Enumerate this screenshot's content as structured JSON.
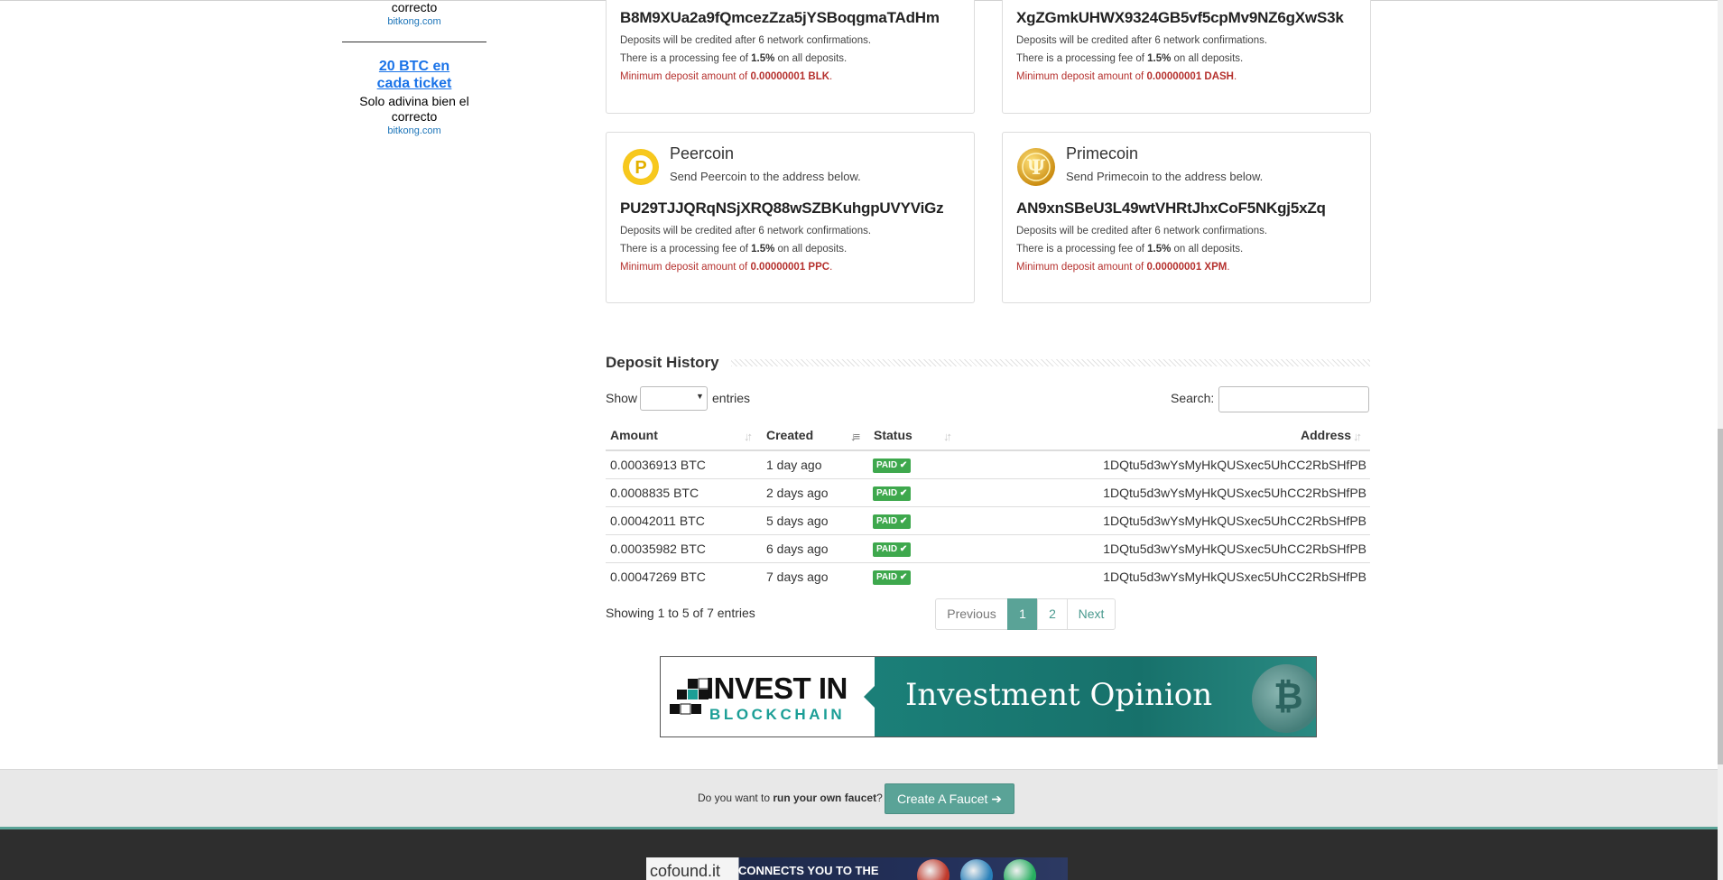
{
  "sidebar": {
    "ad1": {
      "text_tail": "correcto",
      "source": "bitkong.com"
    },
    "ad2": {
      "title": "20 BTC en cada ticket",
      "text": "Solo adivina bien el correcto",
      "source": "bitkong.com"
    }
  },
  "coins": [
    {
      "address": "B8M9XUa2a9fQmcezZza5jYSBoqgmaTAdHm",
      "line1": "Deposits will be credited after 6 network confirmations.",
      "fee_pre": "There is a processing fee of ",
      "fee": "1.5%",
      "fee_post": " on all deposits.",
      "min_pre": "Minimum deposit amount of ",
      "min": "0.00000001 BLK",
      "min_post": "."
    },
    {
      "address": "XgZGmkUHWX9324GB5vf5cpMv9NZ6gXwS3k",
      "line1": "Deposits will be credited after 6 network confirmations.",
      "fee_pre": "There is a processing fee of ",
      "fee": "1.5%",
      "fee_post": " on all deposits.",
      "min_pre": "Minimum deposit amount of ",
      "min": "0.00000001 DASH",
      "min_post": "."
    },
    {
      "name": "Peercoin",
      "send": "Send Peercoin to the address below.",
      "address": "PU29TJJQRqNSjXRQ88wSZBKuhgpUVYViGz",
      "line1": "Deposits will be credited after 6 network confirmations.",
      "fee_pre": "There is a processing fee of ",
      "fee": "1.5%",
      "fee_post": " on all deposits.",
      "min_pre": "Minimum deposit amount of ",
      "min": "0.00000001 PPC",
      "min_post": ".",
      "logo_color": "#f5c518",
      "logo_glyph": "P"
    },
    {
      "name": "Primecoin",
      "send": "Send Primecoin to the address below.",
      "address": "AN9xnSBeU3L49wtVHRtJhxCoF5NKgj5xZq",
      "line1": "Deposits will be credited after 6 network confirmations.",
      "fee_pre": "There is a processing fee of ",
      "fee": "1.5%",
      "fee_post": " on all deposits.",
      "min_pre": "Minimum deposit amount of ",
      "min": "0.00000001 XPM",
      "min_post": ".",
      "logo_color": "#d9a21b",
      "logo_glyph": "Ψ"
    }
  ],
  "history": {
    "title": "Deposit History",
    "show_label": "Show",
    "entries_label": "entries",
    "search_label": "Search:",
    "columns": {
      "amount": "Amount",
      "created": "Created",
      "status": "Status",
      "address": "Address"
    },
    "rows": [
      {
        "amount": "0.00036913 BTC",
        "created": "1 day ago",
        "status": "PAID ✔",
        "address": "1DQtu5d3wYsMyHkQUSxec5UhCC2RbSHfPB"
      },
      {
        "amount": "0.0008835 BTC",
        "created": "2 days ago",
        "status": "PAID ✔",
        "address": "1DQtu5d3wYsMyHkQUSxec5UhCC2RbSHfPB"
      },
      {
        "amount": "0.00042011 BTC",
        "created": "5 days ago",
        "status": "PAID ✔",
        "address": "1DQtu5d3wYsMyHkQUSxec5UhCC2RbSHfPB"
      },
      {
        "amount": "0.00035982 BTC",
        "created": "6 days ago",
        "status": "PAID ✔",
        "address": "1DQtu5d3wYsMyHkQUSxec5UhCC2RbSHfPB"
      },
      {
        "amount": "0.00047269 BTC",
        "created": "7 days ago",
        "status": "PAID ✔",
        "address": "1DQtu5d3wYsMyHkQUSxec5UhCC2RbSHfPB"
      }
    ],
    "info": "Showing 1 to 5 of 7 entries",
    "pagination": {
      "previous": "Previous",
      "page1": "1",
      "page2": "2",
      "next": "Next"
    }
  },
  "banner": {
    "invest": "INVEST IN",
    "blockchain": "BLOCKCHAIN",
    "opinion": "Investment Opinion"
  },
  "footer": {
    "question_pre": "Do you want to ",
    "question_bold": "run your own faucet",
    "question_post": "?",
    "button": "Create A Faucet ➔",
    "ad_logo": "cofound.it",
    "ad_text": "CONNECTS YOU TO THE"
  },
  "colors": {
    "accent": "#5aa397",
    "paid": "#3ea84d",
    "min_text": "#b5312e",
    "link": "#1a73e8"
  }
}
